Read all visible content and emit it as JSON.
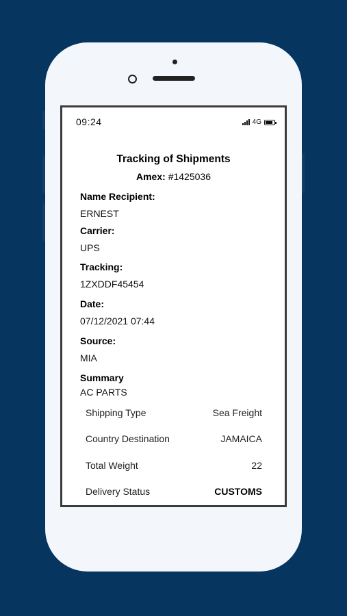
{
  "status": {
    "time": "09:24",
    "network": "4G"
  },
  "header": {
    "title": "Tracking of Shipments",
    "amex_label": "Amex:",
    "amex_value": "#1425036"
  },
  "fields": {
    "recipient_label": "Name Recipient:",
    "recipient_value": "ERNEST",
    "carrier_label": "Carrier:",
    "carrier_value": "UPS",
    "tracking_label": "Tracking:",
    "tracking_value": "1ZXDDF45454",
    "date_label": "Date:",
    "date_value": "07/12/2021 07:44",
    "source_label": "Source:",
    "source_value": "MIA",
    "summary_label": "Summary",
    "summary_value": "AC PARTS"
  },
  "summary": {
    "rows": [
      {
        "key": "Shipping Type",
        "value": "Sea Freight"
      },
      {
        "key": "Country Destination",
        "value": "JAMAICA"
      },
      {
        "key": "Total Weight",
        "value": "22"
      },
      {
        "key": "Delivery Status",
        "value": "CUSTOMS"
      }
    ]
  }
}
